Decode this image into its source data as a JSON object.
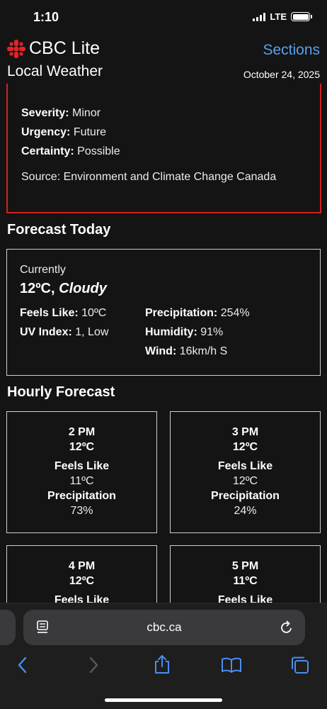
{
  "status": {
    "time": "1:10",
    "network": "LTE"
  },
  "header": {
    "brand": "CBC Lite",
    "subtitle": "Local Weather",
    "sections_label": "Sections",
    "date": "October 24, 2025"
  },
  "alert": {
    "severity_label": "Severity:",
    "severity_value": "Minor",
    "urgency_label": "Urgency:",
    "urgency_value": "Future",
    "certainty_label": "Certainty:",
    "certainty_value": "Possible",
    "source": "Source: Environment and Climate Change Canada"
  },
  "forecast_today": {
    "title": "Forecast Today",
    "currently_label": "Currently",
    "temp": "12ºC,",
    "condition": "Cloudy",
    "feels_like_label": "Feels Like:",
    "feels_like_value": "10ºC",
    "precip_label": "Precipitation:",
    "precip_value": "254%",
    "uv_label": "UV Index:",
    "uv_value": "1, Low",
    "humidity_label": "Humidity:",
    "humidity_value": "91%",
    "wind_label": "Wind:",
    "wind_value": "16km/h S"
  },
  "hourly": {
    "title": "Hourly Forecast",
    "feels_like_label": "Feels Like",
    "precip_label": "Precipitation",
    "items": [
      {
        "time": "2 PM",
        "temp": "12ºC",
        "feels": "11ºC",
        "precip": "73%"
      },
      {
        "time": "3 PM",
        "temp": "12ºC",
        "feels": "12ºC",
        "precip": "24%"
      },
      {
        "time": "4 PM",
        "temp": "12ºC",
        "feels": "",
        "precip": ""
      },
      {
        "time": "5 PM",
        "temp": "11ºC",
        "feels": "",
        "precip": ""
      }
    ]
  },
  "browser": {
    "url": "cbc.ca"
  },
  "colors": {
    "accent_link": "#5aa0ec",
    "alert_border": "#d21f1f",
    "cbc_red": "#e4222a",
    "background": "#141414"
  }
}
